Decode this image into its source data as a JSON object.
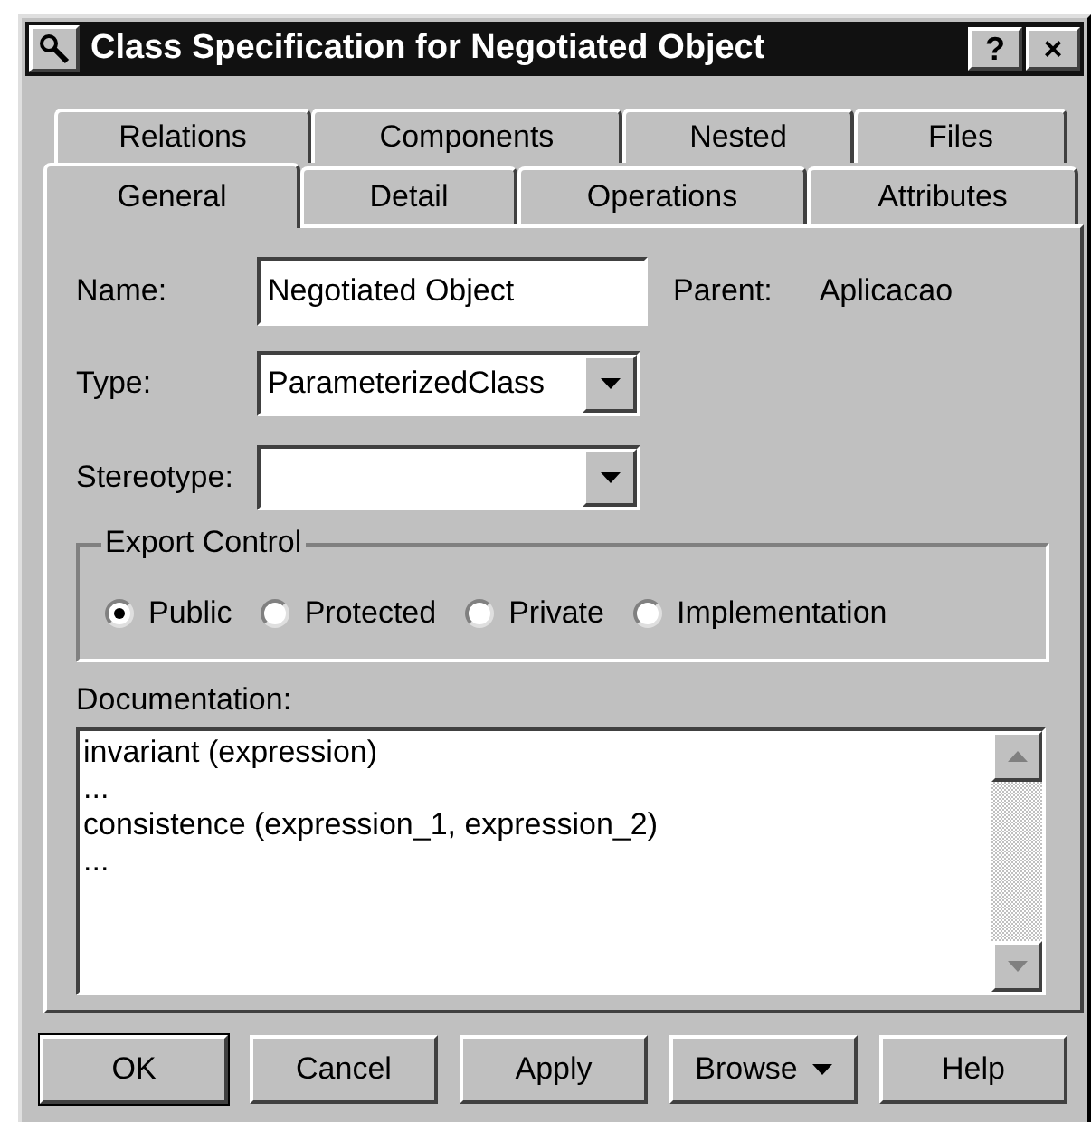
{
  "window": {
    "title": "Class Specification for Negotiated Object",
    "buttons": [
      "?",
      "×"
    ]
  },
  "tabs": {
    "back_row": [
      {
        "label": "Relations",
        "selected": false
      },
      {
        "label": "Components",
        "selected": false
      },
      {
        "label": "Nested",
        "selected": false
      },
      {
        "label": "Files",
        "selected": false
      }
    ],
    "front_row": [
      {
        "label": "General",
        "selected": true
      },
      {
        "label": "Detail",
        "selected": false
      },
      {
        "label": "Operations",
        "selected": false
      },
      {
        "label": "Attributes",
        "selected": false
      }
    ]
  },
  "name": {
    "label": "Name:",
    "value": "Negotiated Object"
  },
  "parent": {
    "label": "Parent:",
    "value": "Aplicacao"
  },
  "type": {
    "label": "Type:",
    "value": "ParameterizedClass"
  },
  "stereotype": {
    "label": "Stereotype:"
  },
  "export_control": {
    "label": "Export Control",
    "options": [
      {
        "label": "Public",
        "selected": true
      },
      {
        "label": "Protected",
        "selected": false
      },
      {
        "label": "Private",
        "selected": false
      },
      {
        "label": "Implementation",
        "selected": false
      }
    ]
  },
  "documentation": {
    "label": "Documentation:",
    "lines": [
      "invariant (expression)",
      "...",
      "consistence (expression_1, expression_2)",
      "..."
    ]
  },
  "buttons": [
    {
      "label": "OK",
      "kind": "default"
    },
    {
      "label": "Cancel",
      "kind": "plain"
    },
    {
      "label": "Apply",
      "kind": "plain"
    },
    {
      "label": "Browse",
      "kind": "menu"
    },
    {
      "label": "Help",
      "kind": "plain"
    }
  ]
}
